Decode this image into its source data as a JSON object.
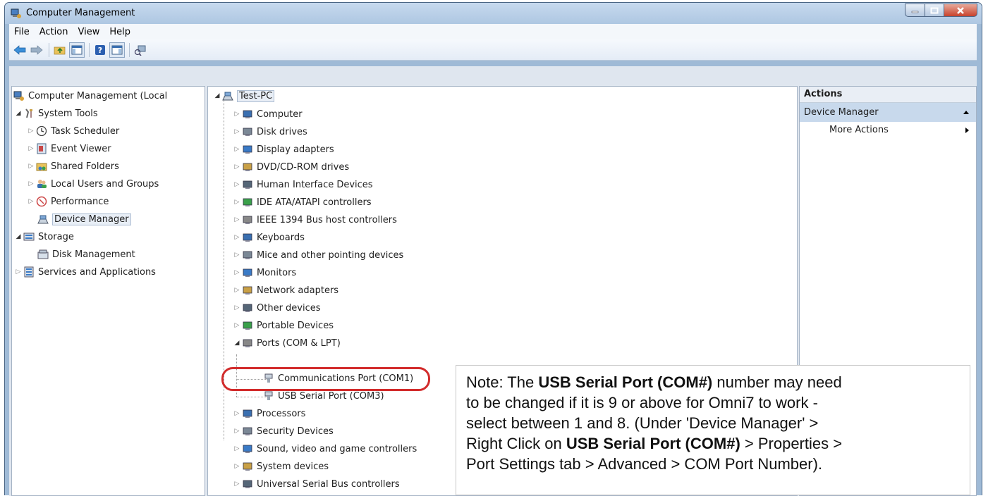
{
  "window": {
    "title": "Computer Management"
  },
  "menu": [
    "File",
    "Action",
    "View",
    "Help"
  ],
  "left_tree": [
    {
      "label": "Computer Management (Local",
      "icon": "computer-mgmt-icon",
      "arrow": ""
    },
    {
      "label": "System Tools",
      "icon": "tools-icon",
      "arrow": "open"
    },
    {
      "label": "Task Scheduler",
      "icon": "clock-icon",
      "arrow": "closed"
    },
    {
      "label": "Event Viewer",
      "icon": "event-viewer-icon",
      "arrow": "closed"
    },
    {
      "label": "Shared Folders",
      "icon": "shared-folder-icon",
      "arrow": "closed"
    },
    {
      "label": "Local Users and Groups",
      "icon": "users-icon",
      "arrow": "closed"
    },
    {
      "label": "Performance",
      "icon": "performance-icon",
      "arrow": "closed"
    },
    {
      "label": "Device Manager",
      "icon": "device-manager-icon",
      "arrow": ""
    },
    {
      "label": "Storage",
      "icon": "storage-icon",
      "arrow": "open"
    },
    {
      "label": "Disk Management",
      "icon": "disk-management-icon",
      "arrow": ""
    },
    {
      "label": "Services and Applications",
      "icon": "services-icon",
      "arrow": "closed"
    }
  ],
  "device_tree": {
    "root": "Test-PC",
    "items": [
      "Computer",
      "Disk drives",
      "Display adapters",
      "DVD/CD-ROM drives",
      "Human Interface Devices",
      "IDE ATA/ATAPI controllers",
      "IEEE 1394 Bus host controllers",
      "Keyboards",
      "Mice and other pointing devices",
      "Monitors",
      "Network adapters",
      "Other devices",
      "Portable Devices",
      "Ports (COM & LPT)"
    ],
    "ports": [
      "Communications Port (COM1)",
      "USB Serial Port (COM3)"
    ],
    "items_after": [
      "Processors",
      "Security Devices",
      "Sound, video and game controllers",
      "System devices",
      "Universal Serial Bus controllers"
    ]
  },
  "actions": {
    "header": "Actions",
    "section": "Device Manager",
    "more": "More Actions"
  },
  "note": {
    "line1_pre": "Note: The ",
    "line1_bold": "USB Serial Port (COM#)",
    "line1_post": " number may need",
    "line2": "to be changed if it is 9 or above for Omni7 to work -",
    "line3": "select between 1 and 8. (Under 'Device Manager' >",
    "line4_pre": "Right Click on ",
    "line4_bold": "USB Serial Port (COM#)",
    "line4_post": " > Properties >",
    "line5": "Port Settings tab > Advanced > COM Port Number)."
  }
}
